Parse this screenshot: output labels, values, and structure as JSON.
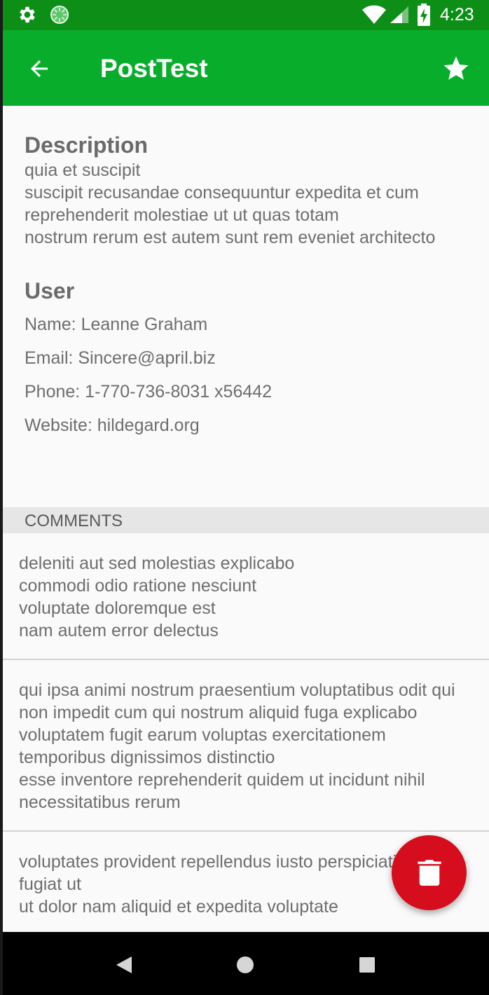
{
  "status_bar": {
    "time": "4:23",
    "icons": [
      "gear-icon",
      "loading-spinner-icon",
      "wifi-icon",
      "cell-signal-icon",
      "battery-charging-icon"
    ]
  },
  "app_bar": {
    "title": "PostTest",
    "back_icon": "arrow-back-icon",
    "favorite_icon": "star-icon"
  },
  "post": {
    "description_heading": "Description",
    "description": "quia et suscipit\nsuscipit recusandae consequuntur expedita et cum reprehenderit molestiae ut ut quas totam\nnostrum rerum est autem sunt rem eveniet architecto",
    "user_heading": "User",
    "user": {
      "name": "Name: Leanne Graham",
      "email": "Email: Sincere@april.biz",
      "phone": "Phone: 1-770-736-8031 x56442",
      "website": "Website: hildegard.org"
    }
  },
  "comments": {
    "header": "COMMENTS",
    "items": [
      {
        "body": "deleniti aut sed molestias explicabo\ncommodi odio ratione nesciunt\nvoluptate doloremque est\nnam autem error delectus"
      },
      {
        "body": "qui ipsa animi nostrum praesentium voluptatibus odit qui non impedit cum qui nostrum aliquid fuga explicabo\nvoluptatem fugit earum voluptas exercitationem temporibus dignissimos distinctio\nesse inventore reprehenderit quidem ut incidunt nihil necessitatibus rerum"
      },
      {
        "body": "voluptates provident repellendus iusto perspiciatis ex fugiat ut\nut dolor nam aliquid et expedita voluptate"
      }
    ]
  },
  "fab": {
    "icon": "trash-icon"
  },
  "nav_bar": {
    "icons": [
      "nav-back-icon",
      "nav-home-icon",
      "nav-recents-icon"
    ]
  },
  "colors": {
    "status_bar": "#0d8f17",
    "app_bar": "#09ad2c",
    "fab": "#d50d1c",
    "comments_header_bg": "#e6e6e6"
  }
}
